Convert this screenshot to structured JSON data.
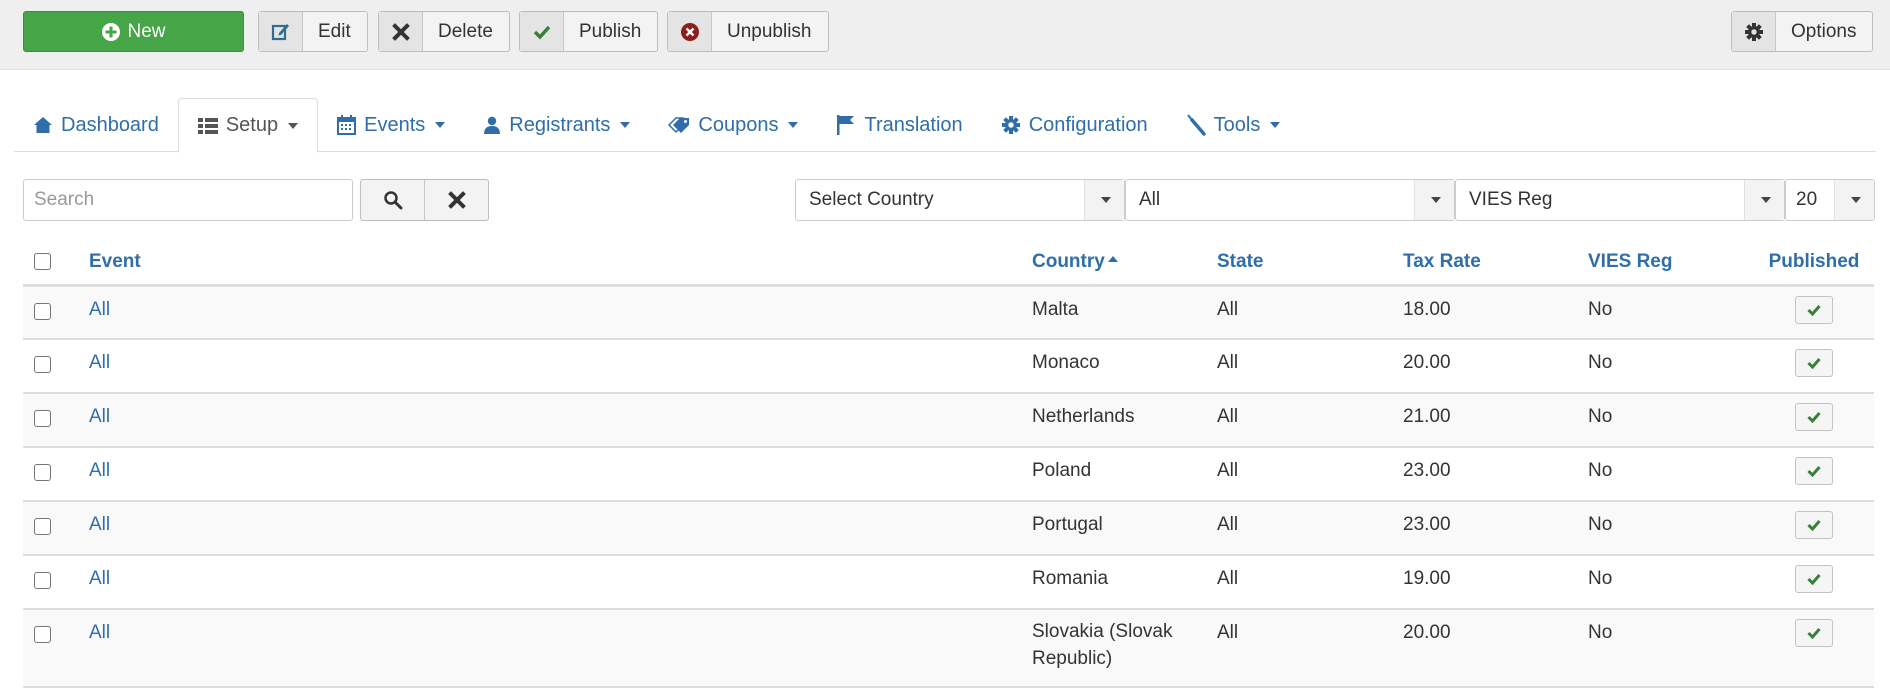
{
  "toolbar": {
    "new_label": "New",
    "edit_label": "Edit",
    "delete_label": "Delete",
    "publish_label": "Publish",
    "unpublish_label": "Unpublish",
    "options_label": "Options"
  },
  "tabs": [
    {
      "label": "Dashboard",
      "icon": "home-icon",
      "dropdown": false,
      "active": false
    },
    {
      "label": "Setup",
      "icon": "list-icon",
      "dropdown": true,
      "active": true
    },
    {
      "label": "Events",
      "icon": "calendar-icon",
      "dropdown": true,
      "active": false
    },
    {
      "label": "Registrants",
      "icon": "user-icon",
      "dropdown": true,
      "active": false
    },
    {
      "label": "Coupons",
      "icon": "tags-icon",
      "dropdown": true,
      "active": false
    },
    {
      "label": "Translation",
      "icon": "flag-icon",
      "dropdown": false,
      "active": false
    },
    {
      "label": "Configuration",
      "icon": "cog-icon",
      "dropdown": false,
      "active": false
    },
    {
      "label": "Tools",
      "icon": "wrench-icon",
      "dropdown": true,
      "active": false
    }
  ],
  "filters": {
    "search_placeholder": "Search",
    "search_value": "",
    "country_select": "Select Country",
    "state_select": "All",
    "vies_select": "VIES Reg",
    "limit_select": "20"
  },
  "table": {
    "headers": {
      "event": "Event",
      "country": "Country",
      "state": "State",
      "tax_rate": "Tax Rate",
      "vies_reg": "VIES Reg",
      "published": "Published"
    },
    "sort": {
      "column": "Country",
      "direction": "asc"
    },
    "rows": [
      {
        "event": "All",
        "country": "Malta",
        "state": "All",
        "tax_rate": "18.00",
        "vies_reg": "No",
        "published": true
      },
      {
        "event": "All",
        "country": "Monaco",
        "state": "All",
        "tax_rate": "20.00",
        "vies_reg": "No",
        "published": true
      },
      {
        "event": "All",
        "country": "Netherlands",
        "state": "All",
        "tax_rate": "21.00",
        "vies_reg": "No",
        "published": true
      },
      {
        "event": "All",
        "country": "Poland",
        "state": "All",
        "tax_rate": "23.00",
        "vies_reg": "No",
        "published": true
      },
      {
        "event": "All",
        "country": "Portugal",
        "state": "All",
        "tax_rate": "23.00",
        "vies_reg": "No",
        "published": true
      },
      {
        "event": "All",
        "country": "Romania",
        "state": "All",
        "tax_rate": "19.00",
        "vies_reg": "No",
        "published": true
      },
      {
        "event": "All",
        "country": "Slovakia (Slovak Republic)",
        "state": "All",
        "tax_rate": "20.00",
        "vies_reg": "No",
        "published": true
      }
    ]
  },
  "colors": {
    "new_button": "#46a546",
    "link": "#2f6eaa",
    "publish_check": "#378137",
    "unpublish": "#8f1d1d"
  }
}
